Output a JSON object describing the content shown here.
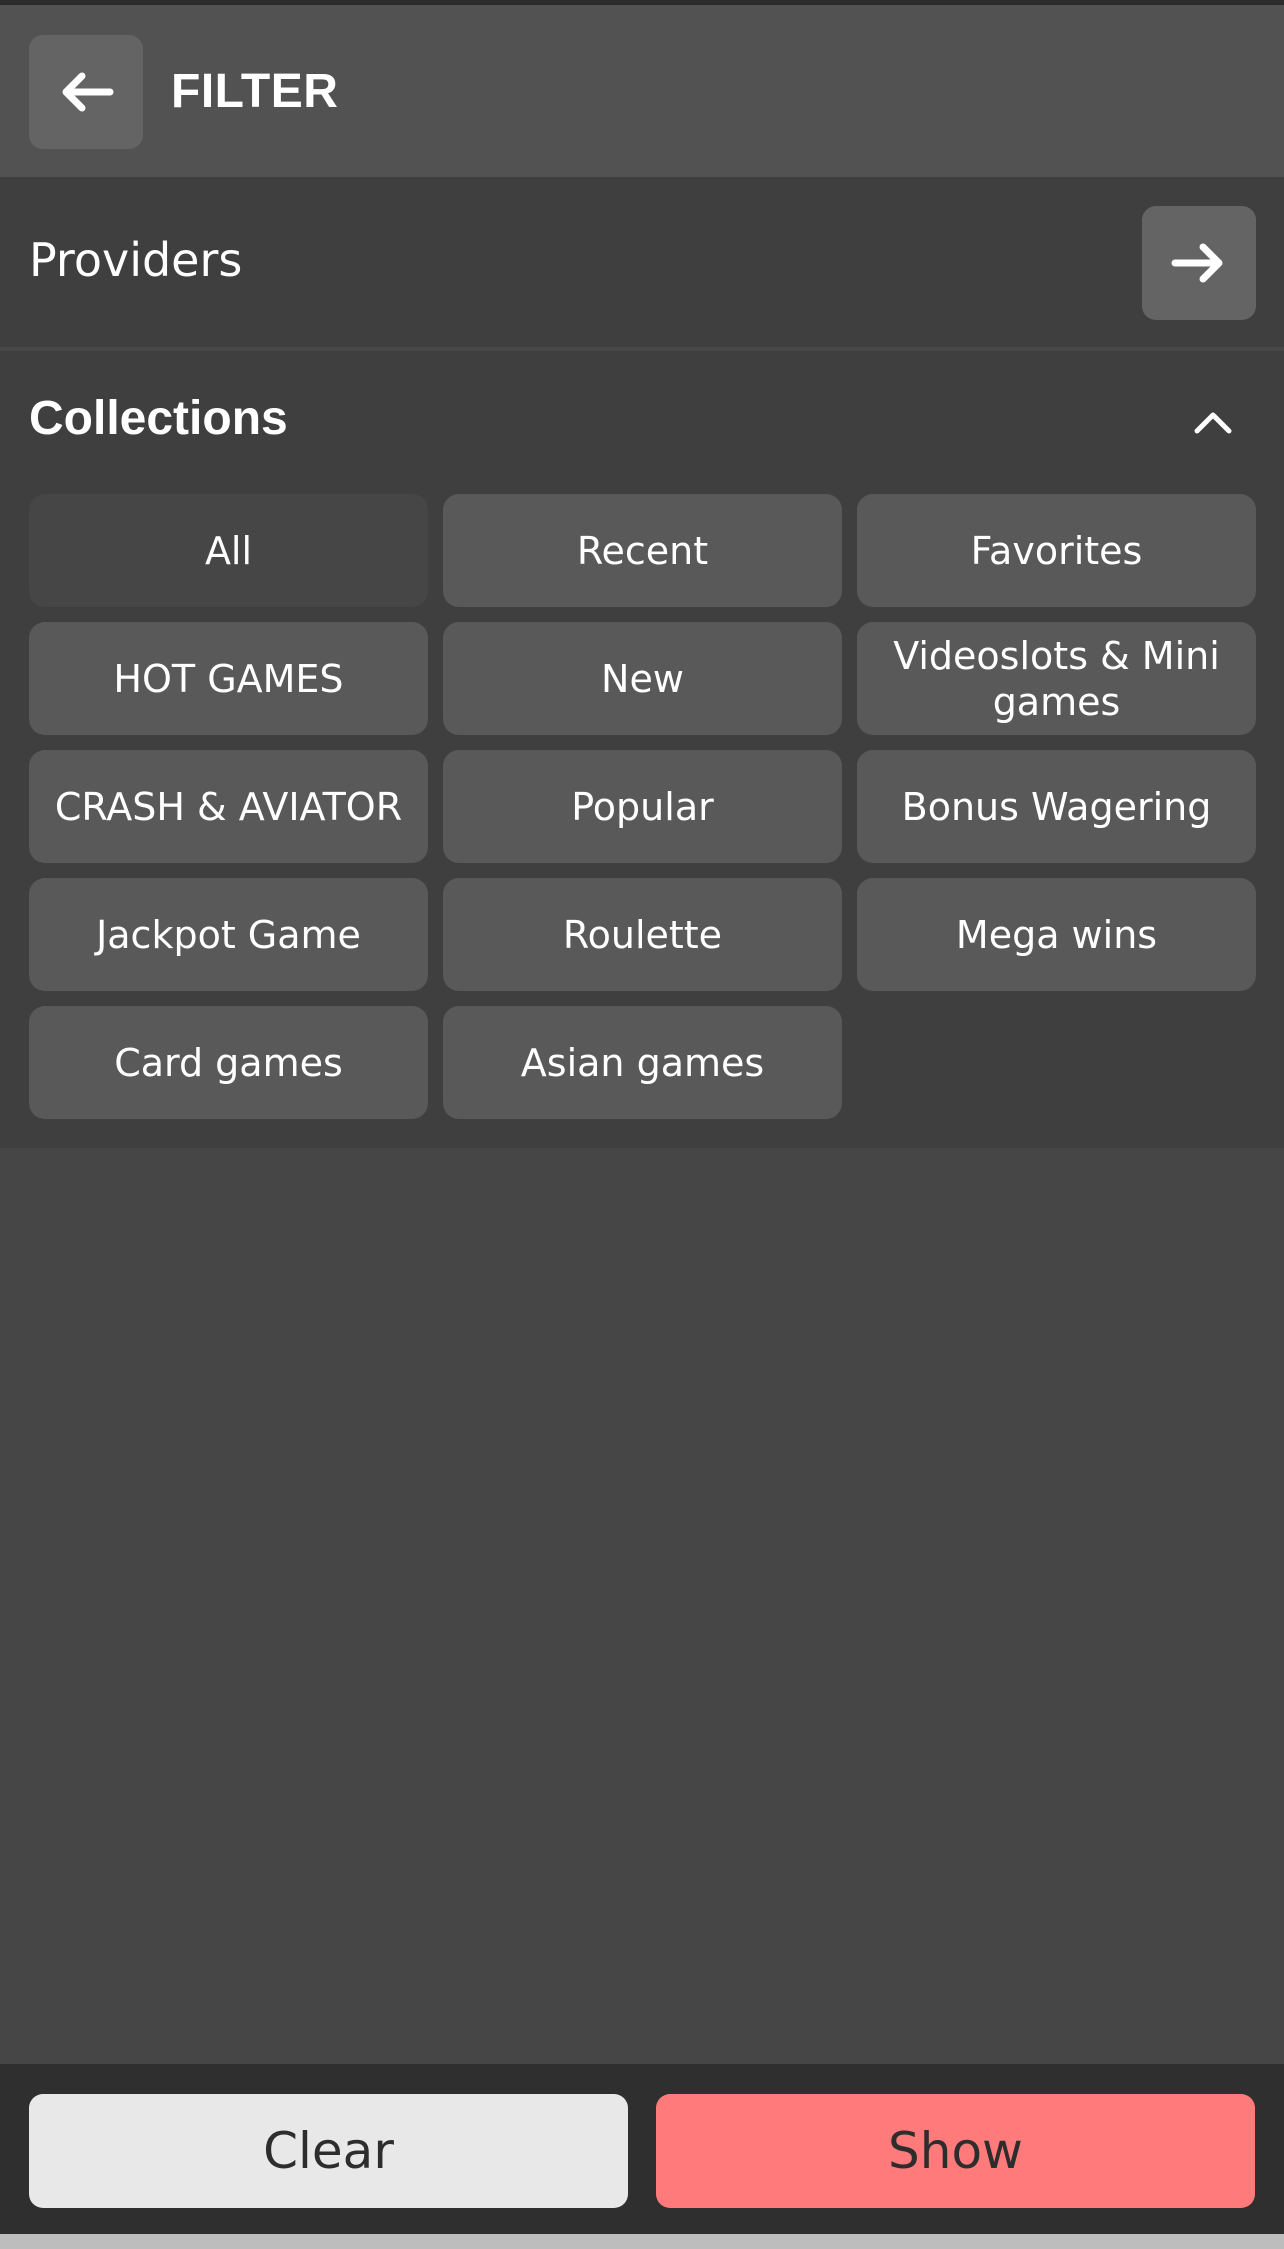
{
  "header": {
    "title": "FILTER",
    "back_icon": "arrow-left-icon"
  },
  "providers": {
    "label": "Providers",
    "open_icon": "arrow-right-icon"
  },
  "collections": {
    "title": "Collections",
    "collapse_icon": "chevron-up-icon",
    "items": [
      {
        "label": "All",
        "selected": true
      },
      {
        "label": "Recent",
        "selected": false
      },
      {
        "label": "Favorites",
        "selected": false
      },
      {
        "label": "HOT GAMES",
        "selected": false
      },
      {
        "label": "New",
        "selected": false
      },
      {
        "label": "Videoslots & Mini games",
        "selected": false
      },
      {
        "label": "CRASH & AVIATOR",
        "selected": false
      },
      {
        "label": "Popular",
        "selected": false
      },
      {
        "label": "Bonus Wagering",
        "selected": false
      },
      {
        "label": "Jackpot Game",
        "selected": false
      },
      {
        "label": "Roulette",
        "selected": false
      },
      {
        "label": "Mega wins",
        "selected": false
      },
      {
        "label": "Card games",
        "selected": false
      },
      {
        "label": "Asian games",
        "selected": false
      }
    ]
  },
  "footer": {
    "clear_label": "Clear",
    "show_label": "Show"
  },
  "colors": {
    "background": "#464646",
    "header": "#525252",
    "panel": "#3f3f3f",
    "chip": "#595959",
    "accent": "#ff7b7b",
    "clear_button": "#e8e8e8"
  }
}
